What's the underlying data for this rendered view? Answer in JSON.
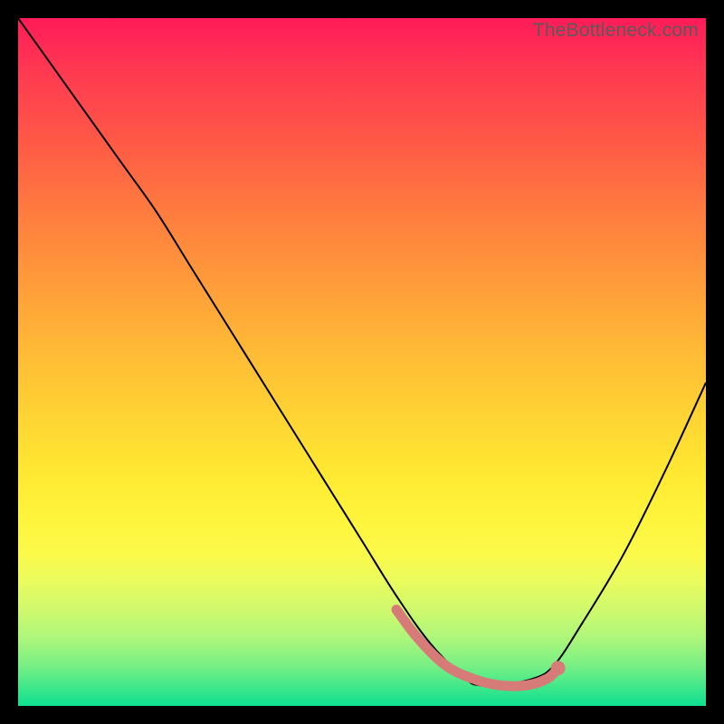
{
  "watermark": "TheBottleneck.com",
  "chart_data": {
    "type": "line",
    "title": "",
    "xlabel": "",
    "ylabel": "",
    "xlim": [
      0,
      100
    ],
    "ylim": [
      0,
      100
    ],
    "series": [
      {
        "name": "bottleneck-curve",
        "x": [
          0,
          5,
          10,
          15,
          20,
          25,
          30,
          35,
          40,
          45,
          50,
          55,
          60,
          65,
          67,
          70,
          75,
          78,
          82,
          88,
          94,
          100
        ],
        "y": [
          100,
          93,
          86,
          79,
          72,
          64,
          56,
          48,
          40,
          32,
          24,
          16,
          9,
          4,
          3,
          3,
          4,
          6,
          12,
          22,
          34,
          47
        ]
      }
    ],
    "highlight": {
      "name": "optimum-range",
      "x": [
        55,
        58,
        62,
        66,
        70,
        74,
        77,
        78.5
      ],
      "y": [
        14,
        10,
        6,
        4,
        3,
        3,
        4,
        5.5
      ]
    },
    "background_gradient": {
      "top": "#ff1b59",
      "mid": "#ffd433",
      "bottom": "#0ee08f"
    }
  }
}
